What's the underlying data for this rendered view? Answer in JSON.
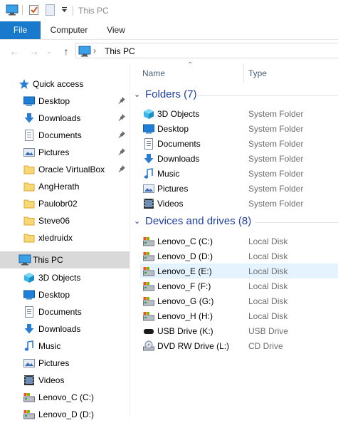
{
  "window": {
    "title": "This PC"
  },
  "ribbon": {
    "tabs": [
      "File",
      "Computer",
      "View"
    ]
  },
  "address": {
    "crumb": "This PC"
  },
  "nav": {
    "quick_access": "Quick access",
    "quick_items": [
      {
        "label": "Desktop",
        "icon": "desktop-icon",
        "pinned": true
      },
      {
        "label": "Downloads",
        "icon": "downloads-icon",
        "pinned": true
      },
      {
        "label": "Documents",
        "icon": "documents-icon",
        "pinned": true
      },
      {
        "label": "Pictures",
        "icon": "pictures-icon",
        "pinned": true
      },
      {
        "label": "Oracle VirtualBox",
        "icon": "folder-icon",
        "pinned": true
      },
      {
        "label": "AngHerath",
        "icon": "folder-icon",
        "pinned": false
      },
      {
        "label": "Paulobr02",
        "icon": "folder-icon",
        "pinned": false
      },
      {
        "label": "Steve06",
        "icon": "folder-icon",
        "pinned": false
      },
      {
        "label": "xledruidx",
        "icon": "folder-icon",
        "pinned": false
      }
    ],
    "this_pc": "This PC",
    "pc_items": [
      {
        "label": "3D Objects",
        "icon": "3d-objects-icon"
      },
      {
        "label": "Desktop",
        "icon": "desktop-icon"
      },
      {
        "label": "Documents",
        "icon": "documents-icon"
      },
      {
        "label": "Downloads",
        "icon": "downloads-icon"
      },
      {
        "label": "Music",
        "icon": "music-icon"
      },
      {
        "label": "Pictures",
        "icon": "pictures-icon"
      },
      {
        "label": "Videos",
        "icon": "videos-icon"
      },
      {
        "label": "Lenovo_C (C:)",
        "icon": "drive-icon"
      },
      {
        "label": "Lenovo_D (D:)",
        "icon": "drive-icon"
      }
    ]
  },
  "columns": {
    "name": "Name",
    "type": "Type"
  },
  "groups": {
    "folders": {
      "title": "Folders (7)",
      "items": [
        {
          "name": "3D Objects",
          "type": "System Folder",
          "icon": "3d-objects-icon"
        },
        {
          "name": "Desktop",
          "type": "System Folder",
          "icon": "desktop-icon"
        },
        {
          "name": "Documents",
          "type": "System Folder",
          "icon": "documents-icon"
        },
        {
          "name": "Downloads",
          "type": "System Folder",
          "icon": "downloads-icon"
        },
        {
          "name": "Music",
          "type": "System Folder",
          "icon": "music-icon"
        },
        {
          "name": "Pictures",
          "type": "System Folder",
          "icon": "pictures-icon"
        },
        {
          "name": "Videos",
          "type": "System Folder",
          "icon": "videos-icon"
        }
      ]
    },
    "devices": {
      "title": "Devices and drives (8)",
      "items": [
        {
          "name": "Lenovo_C (C:)",
          "type": "Local Disk",
          "icon": "drive-icon"
        },
        {
          "name": "Lenovo_D (D:)",
          "type": "Local Disk",
          "icon": "drive-icon"
        },
        {
          "name": "Lenovo_E (E:)",
          "type": "Local Disk",
          "icon": "drive-icon"
        },
        {
          "name": "Lenovo_F (F:)",
          "type": "Local Disk",
          "icon": "drive-icon"
        },
        {
          "name": "Lenovo_G (G:)",
          "type": "Local Disk",
          "icon": "drive-icon"
        },
        {
          "name": "Lenovo_H (H:)",
          "type": "Local Disk",
          "icon": "drive-icon"
        },
        {
          "name": "USB Drive (K:)",
          "type": "USB Drive",
          "icon": "usb-drive-icon"
        },
        {
          "name": "DVD RW Drive (L:)",
          "type": "CD Drive",
          "icon": "dvd-drive-icon"
        }
      ]
    }
  },
  "colors": {
    "accent": "#1979ca",
    "group_title": "#1e3fa0",
    "selected_nav": "#d9d9d9",
    "hover_row": "#e5f3ff"
  }
}
